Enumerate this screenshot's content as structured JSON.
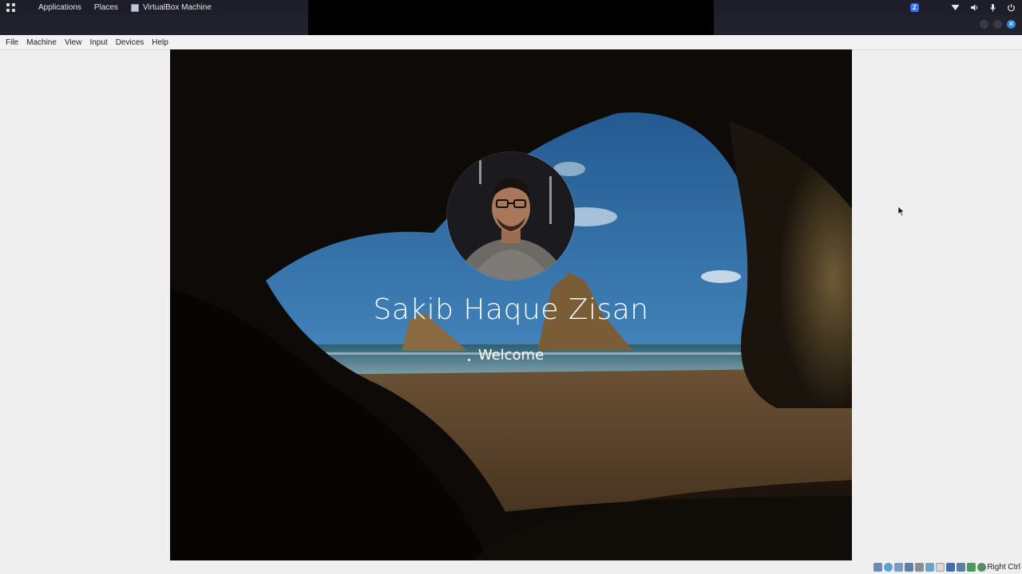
{
  "top_panel": {
    "applications": "Applications",
    "places": "Places",
    "window_title": "VirtualBox Machine",
    "icons": [
      "apps-grid-icon",
      "z-badge-icon",
      "wifi-icon",
      "volume-icon",
      "microphone-icon",
      "power-icon"
    ],
    "z_badge": "Z"
  },
  "menubar": {
    "items": [
      "File",
      "Machine",
      "View",
      "Input",
      "Devices",
      "Help"
    ]
  },
  "login": {
    "user_name": "Sakib Haque Zisan",
    "status": "Welcome"
  },
  "statusbar": {
    "host_key": "Right Ctrl",
    "icons": [
      "hard-disk-icon",
      "optical-drive-icon",
      "audio-icon",
      "network-icon",
      "usb-icon",
      "shared-folders-icon",
      "display-icon",
      "recording-icon",
      "cpu-icon",
      "mouse-integration-icon",
      "keyboard-icon"
    ]
  },
  "colors": {
    "panel_bg": "#1e1e2a",
    "accent_blue": "#2d86e0",
    "menubar_bg": "#f2f2f2"
  }
}
